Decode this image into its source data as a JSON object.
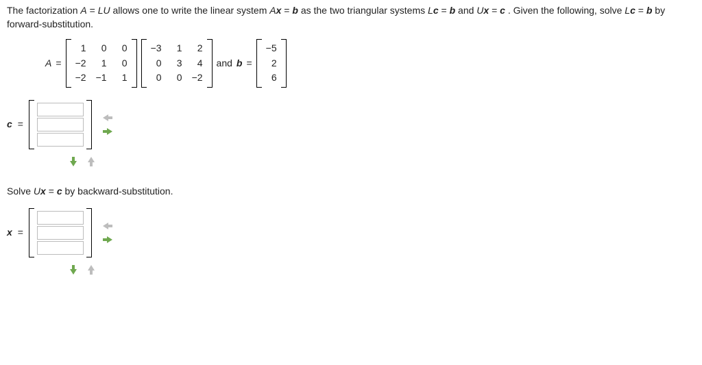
{
  "intro": {
    "p1a": "The factorization ",
    "A": "A",
    "eq": " = ",
    "LU": "LU",
    "p1b": " allows one to write the linear system ",
    "Ax": "A",
    "xvec": "x",
    "eq2": " = ",
    "bvec": "b",
    "p1c": " as the two triangular systems ",
    "L": "L",
    "cvec": "c",
    "p1d": " and ",
    "U": "U",
    "p1e": ". Given the following, solve ",
    "p1f": " by forward-substitution."
  },
  "matrixRow": {
    "Alabel": "A",
    "eq": " = ",
    "L": [
      [
        "1",
        "0",
        "0"
      ],
      [
        "−2",
        "1",
        "0"
      ],
      [
        "−2",
        "−1",
        "1"
      ]
    ],
    "U": [
      [
        "−3",
        "1",
        "2"
      ],
      [
        "0",
        "3",
        "4"
      ],
      [
        "0",
        "0",
        "−2"
      ]
    ],
    "andb": " and ",
    "blabel": "b",
    "b": [
      "−5",
      "2",
      "6"
    ]
  },
  "answer1": {
    "label": "c",
    "eq": " = "
  },
  "section2": {
    "p1": "Solve ",
    "U": "U",
    "xvec": "x",
    "eq": " = ",
    "cvec": "c",
    "p2": " by backward-substitution."
  },
  "answer2": {
    "label": "x",
    "eq": " = "
  }
}
